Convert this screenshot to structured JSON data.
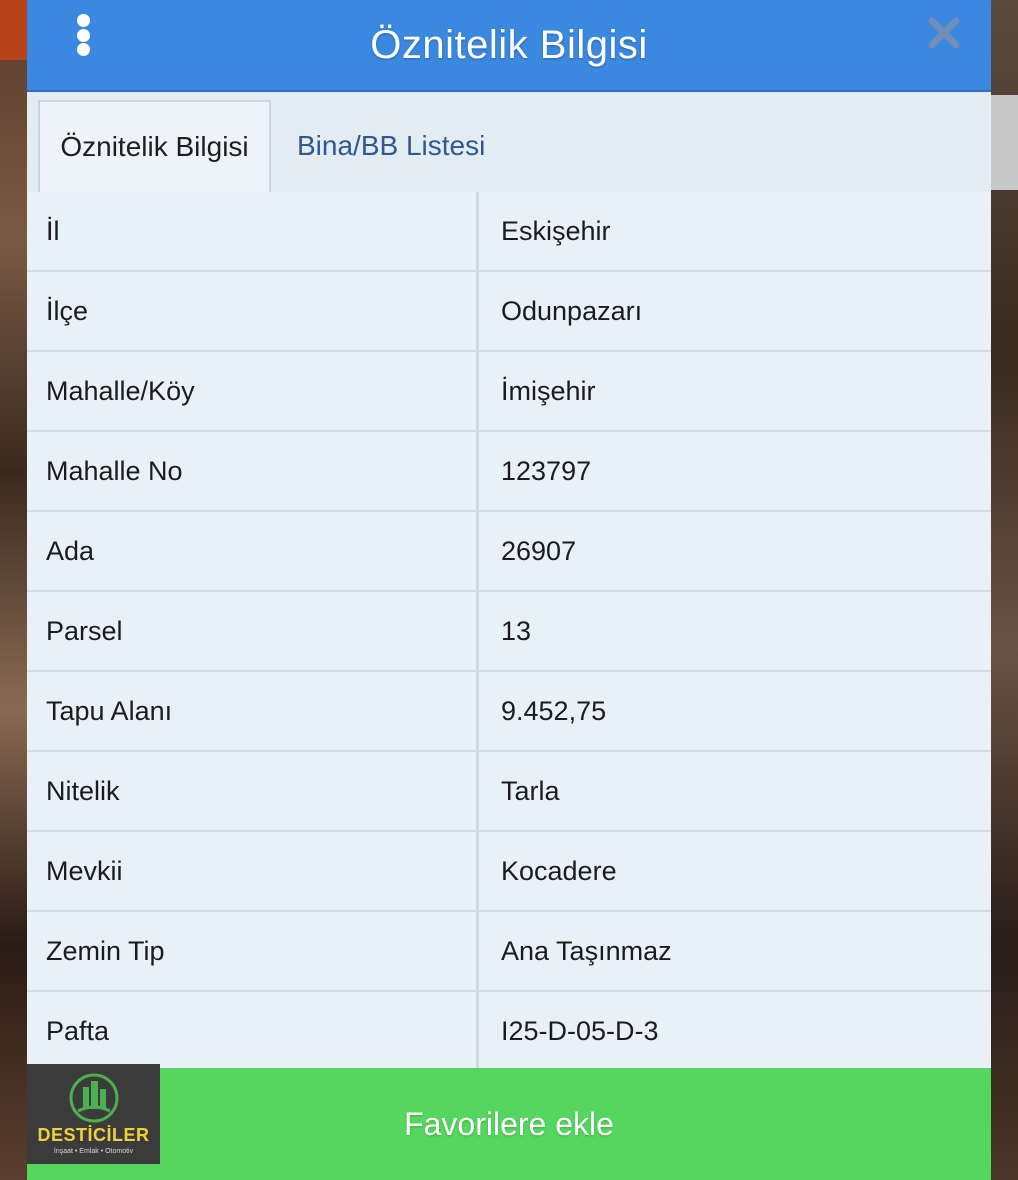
{
  "dialog": {
    "title": "Öznitelik Bilgisi",
    "header_color": "#3a88e0"
  },
  "tabs": [
    {
      "label": "Öznitelik Bilgisi",
      "active": true
    },
    {
      "label": "Bina/BB Listesi",
      "active": false
    }
  ],
  "attributes": [
    {
      "key": "İl",
      "value": "Eskişehir"
    },
    {
      "key": "İlçe",
      "value": "Odunpazarı"
    },
    {
      "key": "Mahalle/Köy",
      "value": "İmişehir"
    },
    {
      "key": "Mahalle No",
      "value": "123797"
    },
    {
      "key": "Ada",
      "value": "26907"
    },
    {
      "key": "Parsel",
      "value": "13"
    },
    {
      "key": "Tapu Alanı",
      "value": "9.452,75"
    },
    {
      "key": "Nitelik",
      "value": "Tarla"
    },
    {
      "key": "Mevkii",
      "value": "Kocadere"
    },
    {
      "key": "Zemin Tip",
      "value": "Ana Taşınmaz"
    },
    {
      "key": "Pafta",
      "value": "I25-D-05-D-3"
    }
  ],
  "footer": {
    "button_label": "Favorilere ekle",
    "button_color": "#55d65f"
  },
  "watermark_logo": {
    "brand": "DESTİCİLER",
    "tagline": "İnşaat • Emlak • Otomotiv"
  },
  "icons": {
    "menu": "vertical-dots-icon",
    "close": "close-icon"
  }
}
